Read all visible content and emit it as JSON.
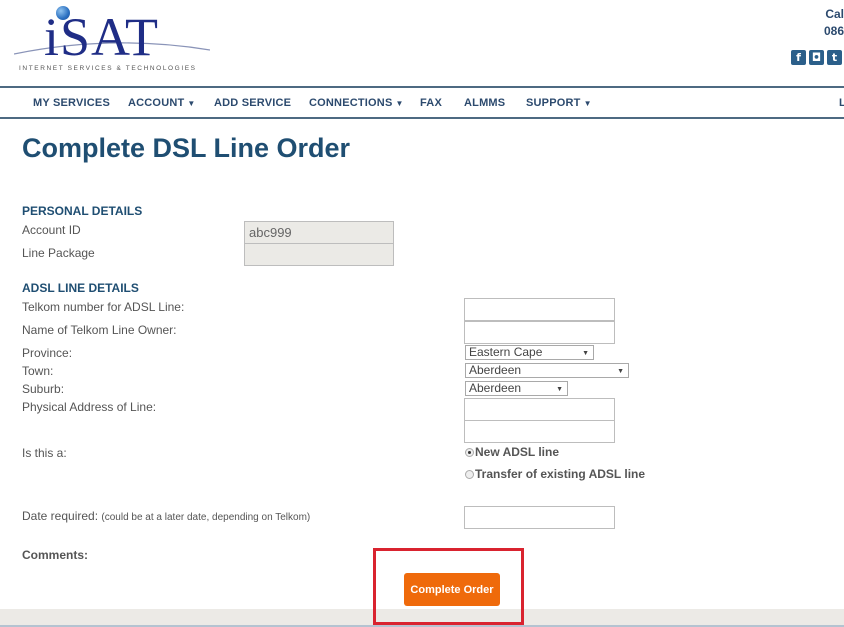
{
  "header": {
    "logo_text": "iSAT",
    "logo_tagline": "INTERNET SERVICES & TECHNOLOGIES",
    "contact_line1": "Cal",
    "contact_line2": "086",
    "social_icons": [
      {
        "name": "facebook-icon",
        "glyph": "f"
      },
      {
        "name": "instagram-icon",
        "glyph": "◘"
      },
      {
        "name": "twitter-icon",
        "glyph": "t"
      }
    ]
  },
  "nav": {
    "items": [
      {
        "label": "MY SERVICES",
        "dropdown": false
      },
      {
        "label": "ACCOUNT",
        "dropdown": true
      },
      {
        "label": "ADD SERVICE",
        "dropdown": false
      },
      {
        "label": "CONNECTIONS",
        "dropdown": true
      },
      {
        "label": "FAX",
        "dropdown": false
      },
      {
        "label": "ALMMS",
        "dropdown": false
      },
      {
        "label": "SUPPORT",
        "dropdown": true
      },
      {
        "label": "L",
        "dropdown": false
      }
    ],
    "caret": "▼"
  },
  "page": {
    "title": "Complete DSL Line Order"
  },
  "personal_details": {
    "heading": "PERSONAL DETAILS",
    "account_id_label": "Account ID",
    "account_id_value": "abc999",
    "line_package_label": "Line Package",
    "line_package_value": ""
  },
  "adsl_details": {
    "heading": "ADSL LINE DETAILS",
    "telkom_number_label": "Telkom number for ADSL Line:",
    "telkom_number_value": "",
    "line_owner_label": "Name of Telkom Line Owner:",
    "line_owner_value": "",
    "province_label": "Province:",
    "province_value": "Eastern Cape",
    "town_label": "Town:",
    "town_value": "Aberdeen",
    "suburb_label": "Suburb:",
    "suburb_value": "Aberdeen",
    "address_label": "Physical Address of Line:",
    "address_line1": "",
    "address_line2": "",
    "line_type_label": "Is this a:",
    "line_type_options": [
      {
        "label": "New ADSL line",
        "checked": true
      },
      {
        "label": "Transfer of existing ADSL line",
        "checked": false
      }
    ],
    "date_label": "Date required:",
    "date_note": "(could be at a later date, depending on Telkom)",
    "date_value": "",
    "comments_label": "Comments:"
  },
  "actions": {
    "complete_label": "Complete Order",
    "button_color": "#ef6a0b",
    "highlight_color": "#d9232f"
  },
  "select_arrow": "▼"
}
